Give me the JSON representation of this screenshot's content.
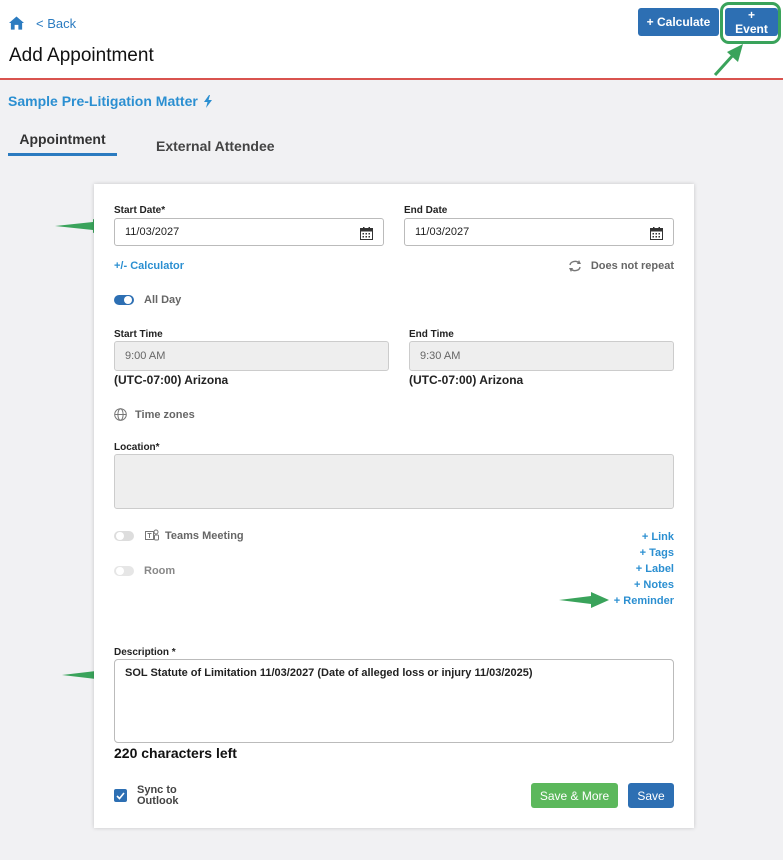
{
  "header": {
    "back_label": "< Back",
    "title": "Add Appointment",
    "calculate_label": "+ Calculate",
    "event_label": "+ Event"
  },
  "matter": {
    "name": "Sample Pre-Litigation Matter"
  },
  "tabs": [
    {
      "label": "Appointment",
      "active": true
    },
    {
      "label": "External Attendee",
      "active": false
    }
  ],
  "form": {
    "start_date_label": "Start Date*",
    "start_date_value": "11/03/2027",
    "end_date_label": "End Date",
    "end_date_value": "11/03/2027",
    "calculator_link": "+/- Calculator",
    "repeat_label": "Does not repeat",
    "all_day_label": "All Day",
    "all_day_on": true,
    "start_time_label": "Start Time",
    "start_time_value": "9:00 AM",
    "end_time_label": "End Time",
    "end_time_value": "9:30 AM",
    "start_tz": "(UTC-07:00) Arizona",
    "end_tz": "(UTC-07:00) Arizona",
    "time_zones_label": "Time zones",
    "location_label": "Location*",
    "location_value": "",
    "teams_label": "Teams Meeting",
    "room_label": "Room",
    "extra_links": [
      "+ Link",
      "+ Tags",
      "+ Label",
      "+ Notes",
      "+ Reminder"
    ],
    "description_label": "Description *",
    "description_value": "SOL Statute of Limitation 11/03/2027 (Date of alleged loss or injury 11/03/2025)",
    "chars_left": "220 characters left",
    "sync_line1": "Sync to",
    "sync_line2": "Outlook",
    "sync_checked": true,
    "save_more_label": "Save & More",
    "save_label": "Save"
  },
  "colors": {
    "primary": "#2d6fb3",
    "link": "#2b8fd1",
    "success": "#5cb85c",
    "annotation_arrow": "#3aa35b",
    "header_rule": "#d9534f"
  }
}
